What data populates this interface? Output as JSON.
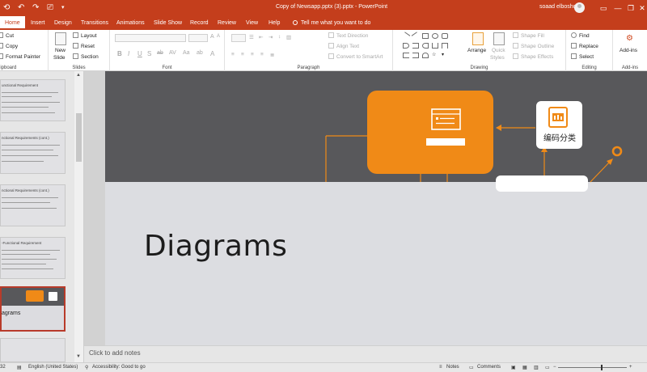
{
  "titlebar": {
    "title": "Copy of Newsapp.pptx (3).pptx  -  PowerPoint",
    "user": "soaad elbosho",
    "minimize": "—",
    "restore": "❐",
    "close": "✕",
    "bg_color": "#c43e1c"
  },
  "tabs": [
    "Home",
    "Insert",
    "Design",
    "Transitions",
    "Animations",
    "Slide Show",
    "Record",
    "Review",
    "View",
    "Help"
  ],
  "tell_me": "Tell me what you want to do",
  "ribbon": {
    "clipboard": {
      "cut": "Cut",
      "copy": "Copy",
      "format_painter": "Format Painter",
      "label": "lipboard"
    },
    "slides": {
      "new_slide": "New",
      "new_slide2": "Slide",
      "layout": "Layout",
      "reset": "Reset",
      "section": "Section",
      "label": "Slides"
    },
    "font": {
      "label": "Font"
    },
    "paragraph": {
      "text_direction": "Text Direction",
      "align_text": "Align Text",
      "convert_smartart": "Convert to SmartArt",
      "label": "Paragraph"
    },
    "drawing": {
      "arrange": "Arrange",
      "quick_styles": "Quick",
      "quick_styles2": "Styles",
      "shape_fill": "Shape Fill",
      "shape_outline": "Shape Outline",
      "shape_effects": "Shape Effects",
      "label": "Drawing"
    },
    "editing": {
      "find": "Find",
      "replace": "Replace",
      "select": "Select",
      "label": "Editing"
    },
    "addins": {
      "addins": "Add-ins",
      "label": "Add-ins"
    }
  },
  "thumbnails": [
    {
      "title": "unctional Requirement"
    },
    {
      "title": "nctional Requirements (cont.)"
    },
    {
      "title": "nctional Requirements (cont.)"
    },
    {
      "title": "-Functional Requirement"
    },
    {
      "title": "agrams"
    }
  ],
  "slide": {
    "title": "Diagrams",
    "icon_label": "编码分类",
    "banner_color": "#58585b",
    "accent_color": "#f08a17"
  },
  "notes_placeholder": "Click to add notes",
  "statusbar": {
    "slide_num": "32",
    "language": "English (United States)",
    "accessibility": "Accessibility: Good to go",
    "notes": "Notes",
    "comments": "Comments"
  }
}
